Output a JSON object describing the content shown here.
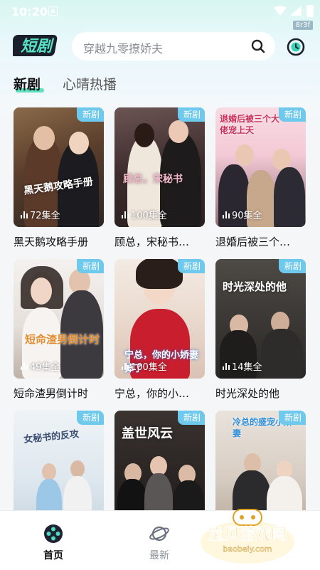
{
  "status_bar": {
    "time": "10:20",
    "notification": "A",
    "corner_tag": "8r3f"
  },
  "header": {
    "logo_text": "短剧",
    "search_placeholder": "穿越九零撩娇夫"
  },
  "tabs": [
    {
      "label": "新剧",
      "active": true
    },
    {
      "label": "心晴热播",
      "active": false
    }
  ],
  "dramas": [
    {
      "title": "黑天鹅攻略手册",
      "badge": "新剧",
      "episodes": "72集全",
      "poster_text": "黑天鹅攻略手册"
    },
    {
      "title": "顾总，宋秘书…",
      "badge": "新剧",
      "episodes": "100集全",
      "poster_text": "顾总，宋秘书"
    },
    {
      "title": "退婚后被三个…",
      "badge": "新剧",
      "episodes": "90集全",
      "poster_text": "退婚后被三个大佬宠上天"
    },
    {
      "title": "短命渣男倒计时",
      "badge": "新剧",
      "episodes": "49集全",
      "poster_text": "短命渣男倒计时"
    },
    {
      "title": "宁总，你的小…",
      "badge": "新剧",
      "episodes": "100集全",
      "poster_text": "宁总，你的小娇妻掉了"
    },
    {
      "title": "时光深处的他",
      "badge": "新剧",
      "episodes": "14集全",
      "poster_text": "时光深处的他"
    },
    {
      "title": "",
      "badge": "新剧",
      "episodes": "",
      "poster_text": "女秘书的反攻"
    },
    {
      "title": "",
      "badge": "新剧",
      "episodes": "",
      "poster_text": "盖世风云"
    },
    {
      "title": "",
      "badge": "新剧",
      "episodes": "",
      "poster_text": "冷总的盛宠小娇妻"
    }
  ],
  "bottom_nav": [
    {
      "label": "首页",
      "icon": "film-reel-icon",
      "active": true
    },
    {
      "label": "最新",
      "icon": "planet-icon",
      "active": false
    }
  ],
  "watermark": {
    "text": "宝贝游戏网",
    "url": "baobeiy.com"
  },
  "colors": {
    "accent": "#18c4a8",
    "badge": "#6fc9ec",
    "nav_active": "#111111",
    "nav_inactive": "#8a8f96"
  }
}
